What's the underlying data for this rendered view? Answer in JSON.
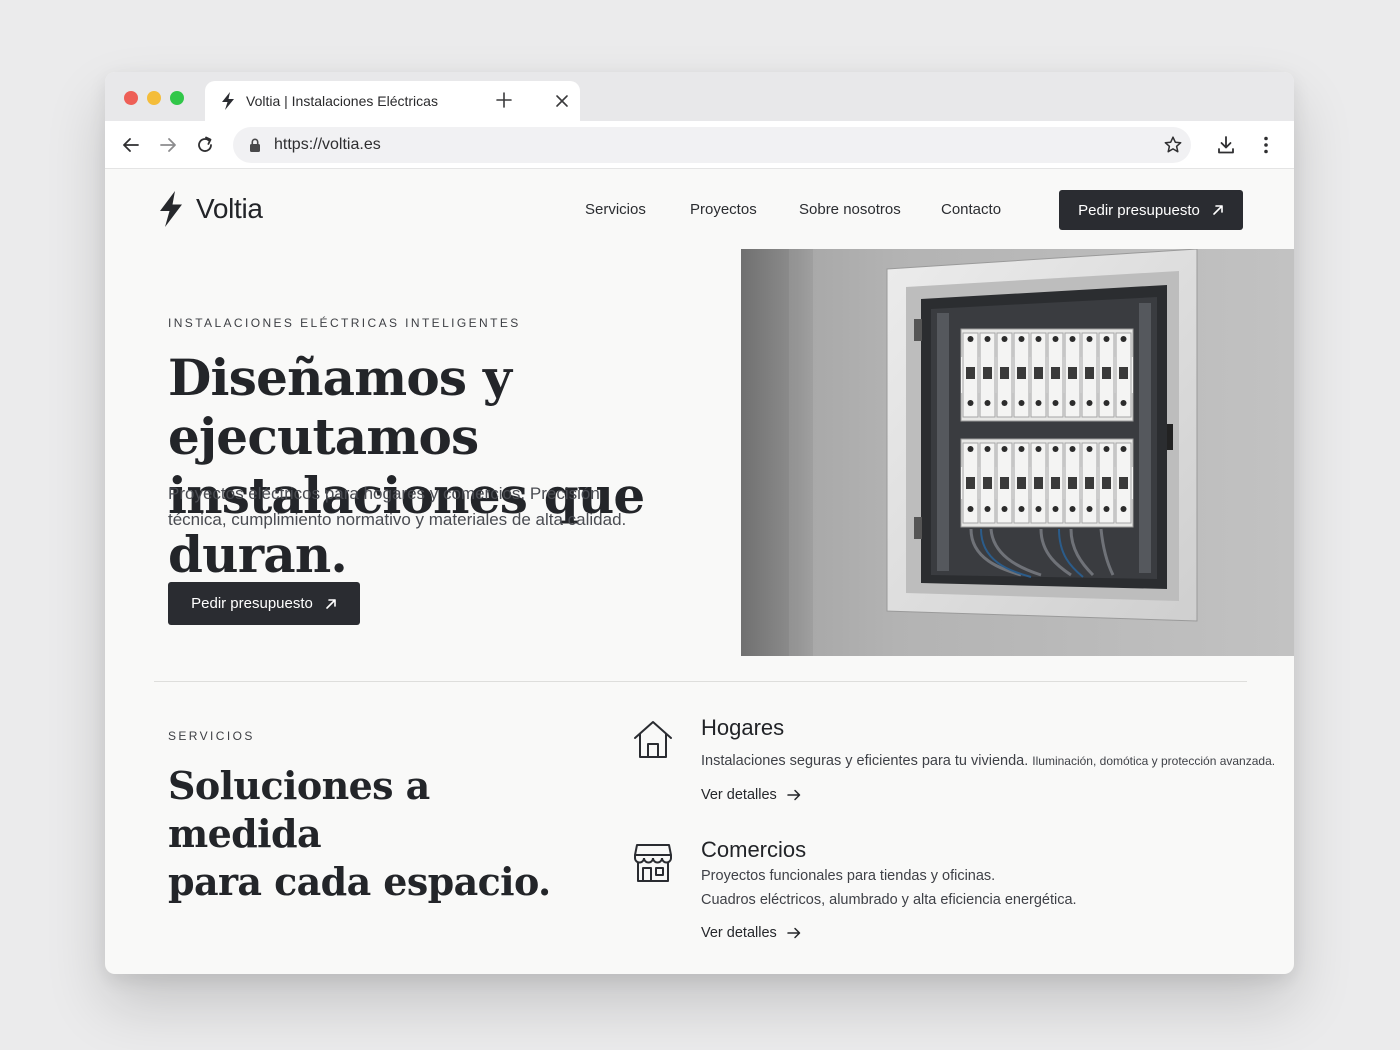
{
  "browser": {
    "tab_title": "Voltia | Instalaciones Eléctricas",
    "url": "https://voltia.es",
    "traffic_lights": {
      "close": "#ee5f57",
      "minimize": "#f4bd3b",
      "zoom": "#31c749"
    }
  },
  "site": {
    "brand": "Voltia",
    "nav": [
      "Servicios",
      "Proyectos",
      "Sobre nosotros",
      "Contacto"
    ],
    "cta_label": "Pedir presupuesto",
    "accent": "#2a2c31"
  },
  "hero": {
    "eyebrow": "INSTALACIONES ELÉCTRICAS INTELIGENTES",
    "title_line1": "Diseñamos y ejecutamos",
    "title_line2": "instalaciones que duran.",
    "subtitle": "Proyectos eléctricos para hogares y comercios. Precisión técnica, cumplimiento normativo y materiales de alta calidad.",
    "cta_label": "Pedir presupuesto"
  },
  "services": {
    "eyebrow": "SERVICIOS",
    "title_line1": "Soluciones a medida",
    "title_line2": "para cada espacio.",
    "items": [
      {
        "icon": "house-icon",
        "title": "Hogares",
        "desc_main": "Instalaciones seguras y eficientes para tu vivienda.",
        "desc_small": "Iluminación, domótica y protección avanzada.",
        "link": "Ver detalles"
      },
      {
        "icon": "storefront-icon",
        "title": "Comercios",
        "desc_line1": "Proyectos funcionales para tiendas y oficinas.",
        "desc_line2": "Cuadros eléctricos, alumbrado y alta eficiencia energética.",
        "link": "Ver detalles"
      }
    ]
  }
}
